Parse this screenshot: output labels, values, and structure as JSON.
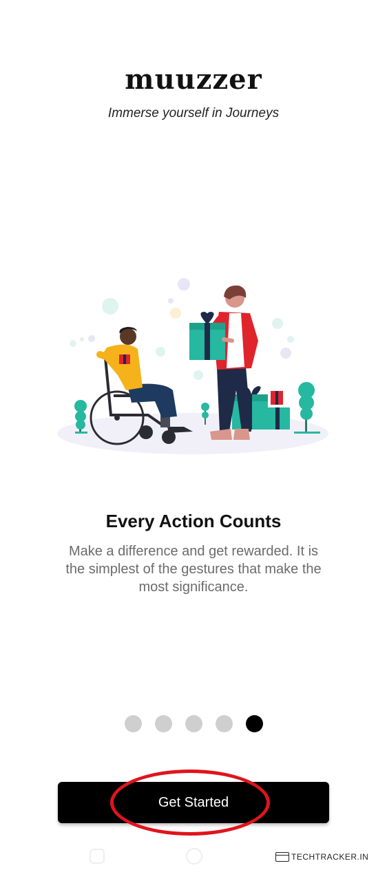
{
  "app": {
    "logo": "muuzzer",
    "tagline": "Immerse yourself in Journeys"
  },
  "slide": {
    "title": "Every Action Counts",
    "description": "Make a difference and get rewarded. It is the simplest of the gestures that make the most significance.",
    "illustration_icon": "gift-giving-illustration"
  },
  "pagination": {
    "total": 5,
    "current": 5
  },
  "cta": {
    "label": "Get Started"
  },
  "annotation": {
    "color": "#e0141c"
  },
  "watermark": {
    "text": "TECHTRACKER.IN",
    "icon": "browser-window-icon"
  },
  "colors": {
    "teal": "#26b8a0",
    "red": "#e0242c",
    "yellow": "#f6b21a",
    "navy": "#1f2a48"
  }
}
